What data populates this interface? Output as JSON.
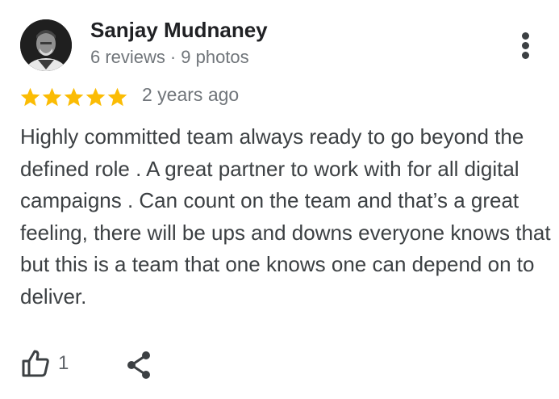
{
  "review": {
    "author": {
      "name": "Sanjay Mudnaney",
      "reviews_count": "6 reviews",
      "separator": "·",
      "photos_count": "9 photos"
    },
    "rating": 5,
    "rating_max": 5,
    "date": "2 years ago",
    "text": "Highly committed team always ready to go beyond the defined role . A great partner to work with for all digital campaigns . Can count on the team and that’s a great feeling, there will be ups and downs everyone knows that but this is a team that one knows one can depend on to deliver.",
    "likes": "1"
  },
  "icons": {
    "more": "more-vert-icon",
    "star": "star-icon",
    "like": "thumb-up-icon",
    "share": "share-icon"
  },
  "colors": {
    "star": "#fbbc04",
    "name": "#202124",
    "meta": "#70757a",
    "body": "#3c4043",
    "icon": "#3c4043"
  }
}
